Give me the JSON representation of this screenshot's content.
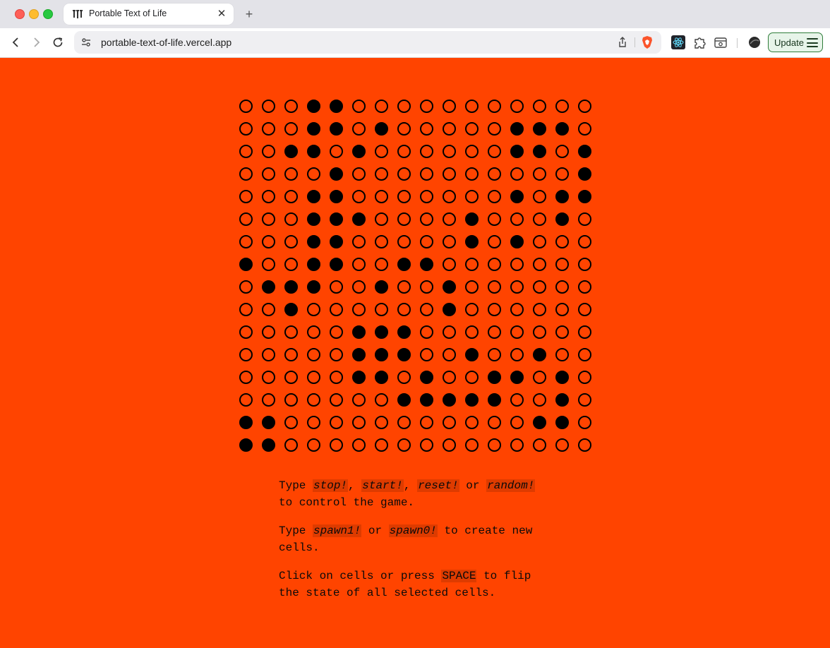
{
  "browser": {
    "tab": {
      "title": "Portable Text of Life",
      "icon": "portable-text-logo-icon"
    },
    "address": {
      "url": "portable-text-of-life.vercel.app"
    },
    "update_label": "Update",
    "colors": {
      "tabstrip": "#e3e3e8",
      "update_border": "#2f7d3a",
      "update_bg": "#e7f4e9"
    }
  },
  "page": {
    "background": "#ff4400",
    "grid": {
      "rows": 16,
      "cols": 16,
      "cells": [
        "0001100000000000",
        "0001101000001110",
        "0011010000001101",
        "0000100000000001",
        "0001100000001011",
        "0001110000100010",
        "0001100000101000",
        "1001100110000000",
        "0111001001000000",
        "0010000001000000",
        "0000011100000000",
        "0000011100100100",
        "0000011010011010",
        "0000000111110010",
        "1100000000000110",
        "1100000000000000"
      ]
    },
    "instructions": {
      "p1": {
        "type": "Type",
        "stop": "stop!",
        "comma1": ",",
        "start": "start!",
        "comma2": ",",
        "reset": "reset!",
        "or": "or",
        "random": "random!",
        "rest": "to control the game."
      },
      "p2": {
        "type": "Type",
        "spawn1": "spawn1!",
        "or": "or",
        "spawn0": "spawn0!",
        "rest": "to create new cells."
      },
      "p3": {
        "start": "Click on cells or press",
        "space": "SPACE",
        "rest": "to flip the state of all selected cells."
      }
    }
  }
}
